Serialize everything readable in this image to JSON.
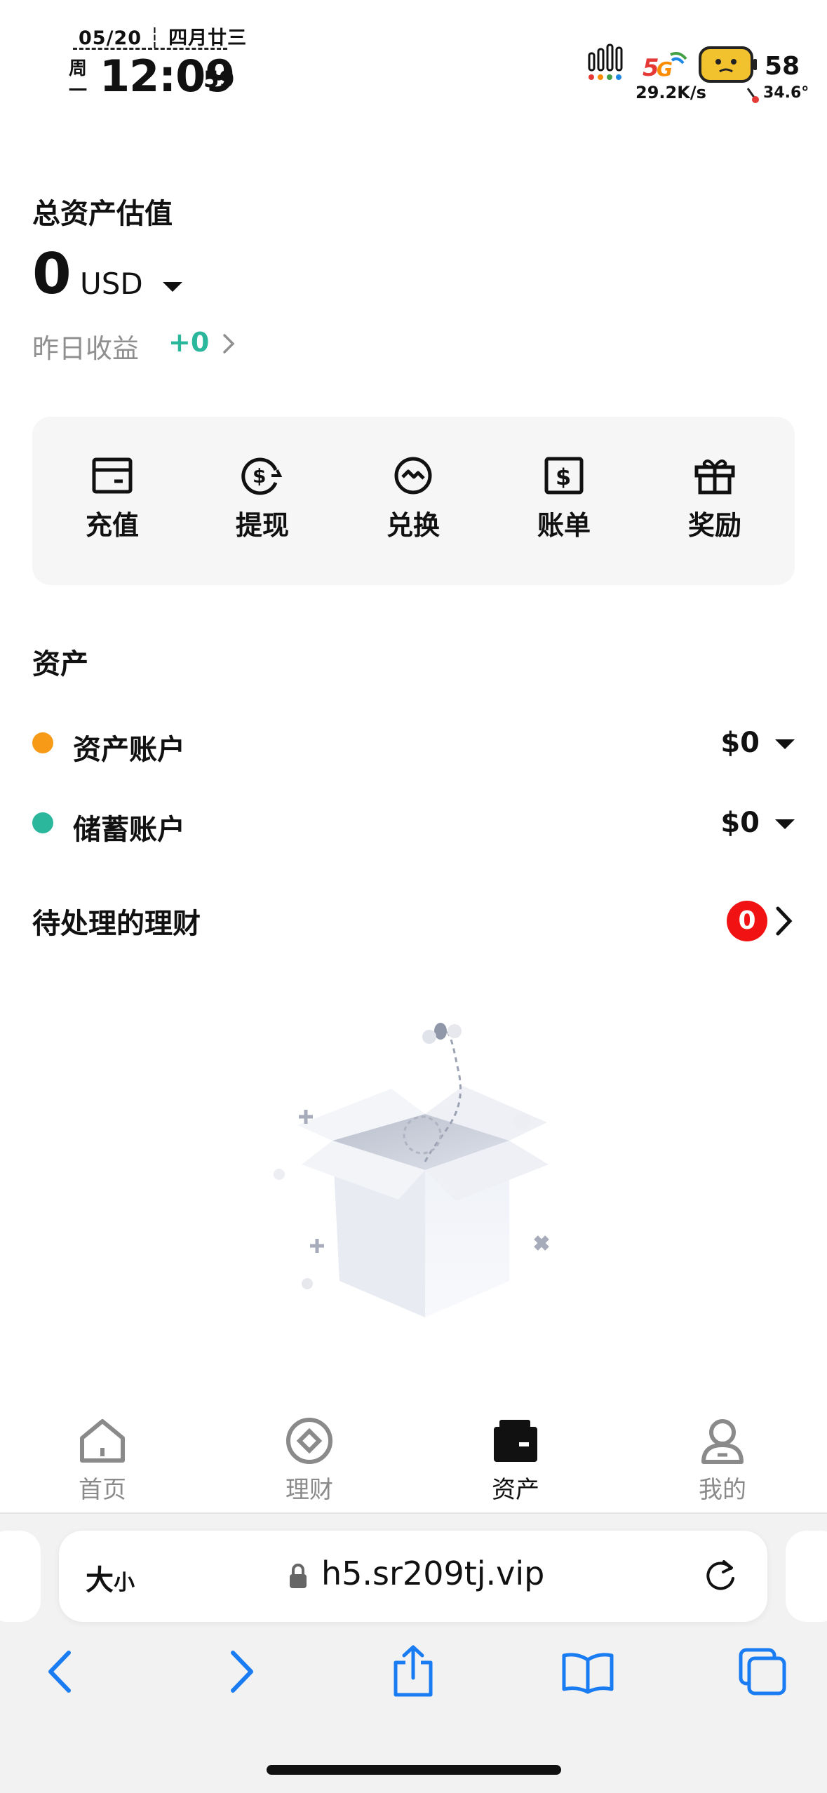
{
  "status_bar": {
    "date": "05/20 ┆ 四月廿三",
    "weekday": "周一",
    "time": "12:09",
    "seconds": "59",
    "network": "5G",
    "speed": "29.2K/s",
    "battery": "58",
    "temperature": "34.6°"
  },
  "header": {
    "title": "总资产估值",
    "total_value": "0",
    "currency": "USD",
    "yesterday_label": "昨日收益",
    "yesterday_value": "+0"
  },
  "quick_actions": [
    {
      "label": "充值",
      "icon": "deposit-icon"
    },
    {
      "label": "提现",
      "icon": "withdraw-icon"
    },
    {
      "label": "兑换",
      "icon": "exchange-icon"
    },
    {
      "label": "账单",
      "icon": "bill-icon"
    },
    {
      "label": "奖励",
      "icon": "gift-icon"
    }
  ],
  "assets": {
    "title": "资产",
    "accounts": [
      {
        "label": "资产账户",
        "value": "$0",
        "color": "#f79a17"
      },
      {
        "label": "储蓄账户",
        "value": "$0",
        "color": "#2ab79c"
      }
    ],
    "pending_title": "待处理的理财",
    "pending_count": "0"
  },
  "tabbar": [
    {
      "label": "首页",
      "icon": "home-icon",
      "active": false
    },
    {
      "label": "理财",
      "icon": "finance-icon",
      "active": false
    },
    {
      "label": "资产",
      "icon": "wallet-icon",
      "active": true
    },
    {
      "label": "我的",
      "icon": "profile-icon",
      "active": false
    }
  ],
  "browser": {
    "text_size": "大",
    "text_size_small": "小",
    "url": "h5.sr209tj.vip"
  },
  "colors": {
    "accent_green": "#2ab79c",
    "accent_orange": "#f79a17",
    "badge_red": "#f11313",
    "safari_blue": "#1a7cf2"
  }
}
